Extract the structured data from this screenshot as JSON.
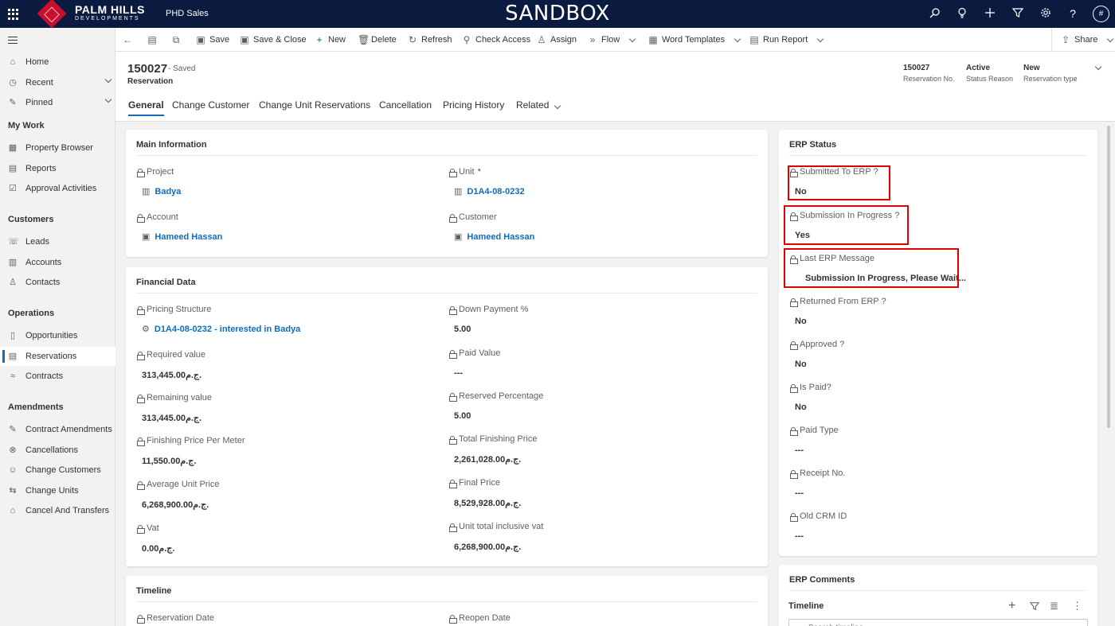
{
  "app": {
    "brand_line1": "PALM HILLS",
    "brand_line2": "DEVELOPMENTS",
    "app_name": "PHD Sales",
    "environment_banner": "SANDBOX"
  },
  "topbar_icons": [
    "search-icon",
    "lightbulb-icon",
    "plus-icon",
    "filter-icon",
    "gear-icon",
    "help-icon",
    "avatar"
  ],
  "avatar_initial": "#",
  "toolbar": {
    "save": "Save",
    "save_close": "Save & Close",
    "new": "New",
    "delete": "Delete",
    "refresh": "Refresh",
    "check_access": "Check Access",
    "assign": "Assign",
    "flow": "Flow",
    "word_templates": "Word Templates",
    "run_report": "Run Report",
    "share": "Share"
  },
  "sidebar": {
    "home": "Home",
    "recent": "Recent",
    "pinned": "Pinned",
    "my_work": "My Work",
    "property_browser": "Property Browser",
    "reports": "Reports",
    "approval_activities": "Approval Activities",
    "customers": "Customers",
    "leads": "Leads",
    "accounts": "Accounts",
    "contacts": "Contacts",
    "operations": "Operations",
    "opportunities": "Opportunities",
    "reservations": "Reservations",
    "contracts": "Contracts",
    "amendments": "Amendments",
    "contract_amendments": "Contract Amendments",
    "cancellations": "Cancellations",
    "change_customers": "Change Customers",
    "change_units": "Change Units",
    "cancel_and_transfers": "Cancel And Transfers"
  },
  "record": {
    "number": "150027",
    "saved_status": "- Saved",
    "entity": "Reservation",
    "header_fields": [
      {
        "value": "150027",
        "label": "Reservation No."
      },
      {
        "value": "Active",
        "label": "Status Reason"
      },
      {
        "value": "New",
        "label": "Reservation type"
      }
    ]
  },
  "tabs": [
    "General",
    "Change Customer",
    "Change Unit Reservations",
    "Cancellation",
    "Pricing History",
    "Related"
  ],
  "main_info": {
    "title": "Main Information",
    "project_label": "Project",
    "project_value": "Badya",
    "unit_label": "Unit",
    "unit_required": "*",
    "unit_value": "D1A4-08-0232",
    "account_label": "Account",
    "account_value": "Hameed Hassan",
    "customer_label": "Customer",
    "customer_value": "Hameed Hassan"
  },
  "financial": {
    "title": "Financial Data",
    "pricing_structure_label": "Pricing Structure",
    "pricing_structure_value": "D1A4-08-0232 - interested in Badya",
    "down_payment_label": "Down Payment %",
    "down_payment_value": "5.00",
    "required_value_label": "Required value",
    "required_value_value": "313,445.00ج.م.",
    "paid_value_label": "Paid Value",
    "paid_value_value": "---",
    "remaining_value_label": "Remaining value",
    "remaining_value_value": "313,445.00ج.م.",
    "reserved_pct_label": "Reserved Percentage",
    "reserved_pct_value": "5.00",
    "finishing_price_meter_label": "Finishing Price Per Meter",
    "finishing_price_meter_value": "11,550.00ج.م.",
    "total_finishing_label": "Total Finishing Price",
    "total_finishing_value": "2,261,028.00ج.م.",
    "avg_unit_price_label": "Average Unit Price",
    "avg_unit_price_value": "6,268,900.00ج.م.",
    "final_price_label": "Final Price",
    "final_price_value": "8,529,928.00ج.م.",
    "vat_label": "Vat",
    "vat_value": "0.00ج.م.",
    "unit_total_vat_label": "Unit total inclusive vat",
    "unit_total_vat_value": "6,268,900.00ج.م."
  },
  "timeline_section": {
    "title": "Timeline",
    "reservation_date_label": "Reservation Date",
    "reopen_date_label": "Reopen Date"
  },
  "erp_status": {
    "title": "ERP Status",
    "submitted_label": "Submitted To ERP ?",
    "submitted_value": "No",
    "in_progress_label": "Submission In Progress ?",
    "in_progress_value": "Yes",
    "last_msg_label": "Last ERP Message",
    "last_msg_value": "Submission In Progress, Please Wait...",
    "returned_label": "Returned From ERP ?",
    "returned_value": "No",
    "approved_label": "Approved ?",
    "approved_value": "No",
    "is_paid_label": "Is Paid?",
    "is_paid_value": "No",
    "paid_type_label": "Paid Type",
    "paid_type_value": "---",
    "receipt_label": "Receipt No.",
    "receipt_value": "---",
    "old_crm_label": "Old CRM ID",
    "old_crm_value": "---"
  },
  "erp_comments": {
    "title": "ERP Comments",
    "timeline_label": "Timeline",
    "search_placeholder": "Search timeline"
  },
  "colors": {
    "topbar": "#0b1b3f",
    "brand_red": "#c8102e",
    "link": "#0f6cbd",
    "highlight_box": "#dd0000"
  }
}
